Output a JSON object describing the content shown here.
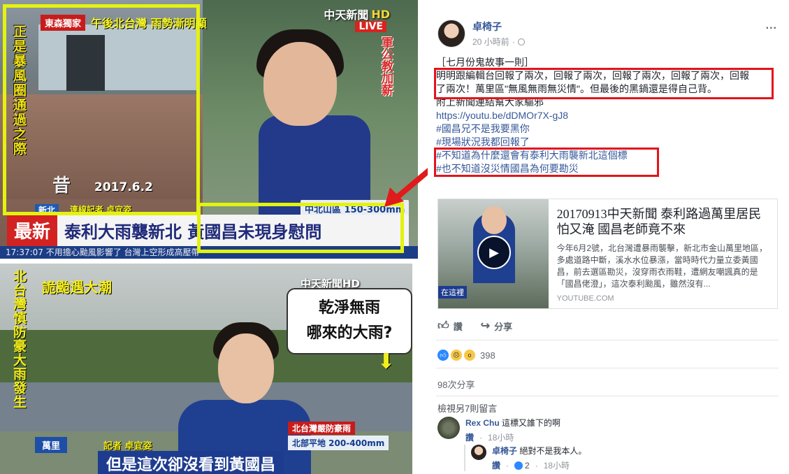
{
  "left_images": {
    "top": {
      "breaking_tag": "東森獨家",
      "strip_text": "午後北台灣 雨勢漸明顯",
      "vertical_left": "正是暴風圈通過之際",
      "vertical_right": "軍公教加薪",
      "channel": "中天新聞",
      "channel_hd": "HD",
      "live": "LIVE",
      "date": "2017.6.2",
      "ghost_char": "昔",
      "region": "新北",
      "reporter": "連線記者 卓宜姿",
      "rain_range": "中北山區 150-300mm",
      "flash": "最新",
      "headline": "泰利大雨襲新北 黃國昌未現身慰問",
      "ticker": "17:37:07 不用擔心颱風影響了 台灣上空形成高壓帶"
    },
    "bottom": {
      "program": "詭颱遇大潮",
      "channel": "中天新聞HD",
      "vertical_text": "北台灣慎防豪大雨發生",
      "bubble_line1": "乾淨無雨",
      "bubble_line2": "哪來的大雨?",
      "down_arrow": "⬇",
      "location": "萬里",
      "reporter": "記者 卓宜姿",
      "alert": "北台灣嚴防豪雨",
      "rain_range": "北部平地 200-400mm",
      "headline": "但是這次卻沒看到黃國昌"
    }
  },
  "post": {
    "author": "卓椅子",
    "time": "20 小時前",
    "more": "...",
    "lines": [
      "［七月份鬼故事一則］",
      "明明跟編輯台回報了兩次，回報了兩次，回報了兩次，回報了兩次，回報",
      "了兩次！萬里區\"無風無雨無災情\"。但最後的黑鍋還是得自己背。",
      "附上新聞連結幫大家驅邪",
      "https://youtu.be/dDMOr7X-gJ8",
      "#國昌兄不是我要黑你",
      "#現場狀況我都回報了",
      "#不知道為什麼還會有泰利大雨襲新北這個標",
      "#也不知道沒災情國昌為何要勘災"
    ],
    "link_card": {
      "title": "20170913中天新聞 泰利路過萬里居民怕又淹 國昌老師竟不來",
      "description": "今年6月2號，北台灣遭暴雨襲擊，新北市金山萬里地區，多處道路中斷，溪水水位暴漲，當時時代力量立委黃國昌，前去選區勘災，沒穿雨衣雨鞋，遭網友嘲諷真的是「國昌佬澄」，這次泰利颱風，雖然沒有...",
      "source": "YOUTUBE.COM",
      "thumb_caption": "在這裡"
    },
    "actions": {
      "like": "讚",
      "share": "分享"
    },
    "reaction_count": "398",
    "share_count": "98次分享",
    "view_more": "檢視另7則留言",
    "comments": [
      {
        "author": "Rex Chu",
        "text": "這標又誰下的啊",
        "like": "讚",
        "time": "18小時"
      },
      {
        "author": "卓椅子",
        "text": "絕對不是我本人。",
        "like": "讚",
        "reacts": "2",
        "time": "18小時"
      }
    ]
  },
  "colors": {
    "highlight": "#e3141b",
    "fb_link": "#365899",
    "yellow_box": "#e4f20f"
  }
}
